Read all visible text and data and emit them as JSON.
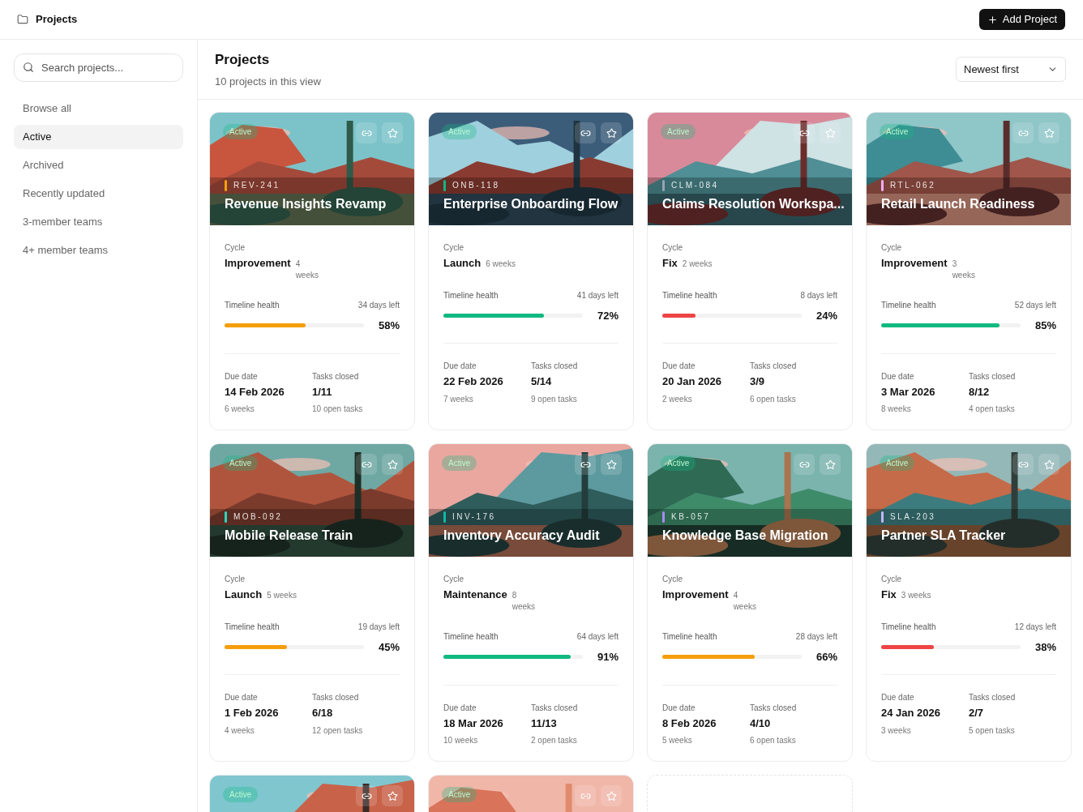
{
  "header": {
    "title": "Projects",
    "action": "Add Project"
  },
  "sidebar": {
    "search": {
      "placeholder": "Search projects..."
    },
    "items": [
      {
        "label": "Browse all",
        "selected": false
      },
      {
        "label": "Active",
        "selected": true
      },
      {
        "label": "Archived",
        "selected": false
      },
      {
        "label": "Recently updated",
        "selected": false
      },
      {
        "label": "3-member teams",
        "selected": false
      },
      {
        "label": "4+ member teams",
        "selected": false
      }
    ]
  },
  "main": {
    "title": "Projects",
    "subtitle": "10 projects in this view",
    "sort": "Newest first"
  },
  "cards": [
    {
      "kind": "full",
      "status": "Active",
      "code": "REV-241",
      "color": "#f59e0b",
      "title": "Revenue Insights Revamp",
      "cycle_label": "Cycle",
      "cycle": "Improvement",
      "cycle_length": "4 weeks",
      "health_label": "Timeline health",
      "days_left": "34 days left",
      "progress": {
        "level": 0.58,
        "color": "#f59e0b"
      },
      "percent": "58%",
      "due_label": "Due date",
      "due": "14 Feb 2026",
      "due_sub": "6 weeks",
      "tasks_label": "Tasks closed",
      "tasks": "1/11",
      "tasks_sub": "10 open tasks"
    },
    {
      "kind": "full",
      "status": "Active",
      "code": "ONB-118",
      "color": "#10b981",
      "title": "Enterprise Onboarding Flow",
      "cycle_label": "Cycle",
      "cycle": "Launch",
      "cycle_length": "6 weeks",
      "health_label": "Timeline health",
      "days_left": "41 days left",
      "progress": {
        "level": 0.72,
        "color": "#10b981"
      },
      "percent": "72%",
      "due_label": "Due date",
      "due": "22 Feb 2026",
      "due_sub": "7 weeks",
      "tasks_label": "Tasks closed",
      "tasks": "5/14",
      "tasks_sub": "9 open tasks"
    },
    {
      "kind": "full",
      "status": "Active",
      "code": "CLM-084",
      "color": "#94a3b8",
      "title": "Claims Resolution Workspa...",
      "cycle_label": "Cycle",
      "cycle": "Fix",
      "cycle_length": "2 weeks",
      "health_label": "Timeline health",
      "days_left": "8 days left",
      "progress": {
        "level": 0.24,
        "color": "#ef4444"
      },
      "percent": "24%",
      "due_label": "Due date",
      "due": "20 Jan 2026",
      "due_sub": "2 weeks",
      "tasks_label": "Tasks closed",
      "tasks": "3/9",
      "tasks_sub": "6 open tasks"
    },
    {
      "kind": "full",
      "status": "Active",
      "code": "RTL-062",
      "color": "#f0abfc",
      "title": "Retail Launch Readiness",
      "cycle_label": "Cycle",
      "cycle": "Improvement",
      "cycle_length": "3 weeks",
      "health_label": "Timeline health",
      "days_left": "52 days left",
      "progress": {
        "level": 0.85,
        "color": "#10b981"
      },
      "percent": "85%",
      "due_label": "Due date",
      "due": "3 Mar 2026",
      "due_sub": "8 weeks",
      "tasks_label": "Tasks closed",
      "tasks": "8/12",
      "tasks_sub": "4 open tasks"
    },
    {
      "kind": "full",
      "status": "Active",
      "code": "MOB-092",
      "color": "#2dd4bf",
      "title": "Mobile Release Train",
      "cycle_label": "Cycle",
      "cycle": "Launch",
      "cycle_length": "5 weeks",
      "health_label": "Timeline health",
      "days_left": "19 days left",
      "progress": {
        "level": 0.45,
        "color": "#f59e0b"
      },
      "percent": "45%",
      "due_label": "Due date",
      "due": "1 Feb 2026",
      "due_sub": "4 weeks",
      "tasks_label": "Tasks closed",
      "tasks": "6/18",
      "tasks_sub": "12 open tasks"
    },
    {
      "kind": "full",
      "status": "Active",
      "code": "INV-176",
      "color": "#14b8a6",
      "title": "Inventory Accuracy Audit",
      "cycle_label": "Cycle",
      "cycle": "Maintenance",
      "cycle_length": "8 weeks",
      "health_label": "Timeline health",
      "days_left": "64 days left",
      "progress": {
        "level": 0.91,
        "color": "#10b981"
      },
      "percent": "91%",
      "due_label": "Due date",
      "due": "18 Mar 2026",
      "due_sub": "10 weeks",
      "tasks_label": "Tasks closed",
      "tasks": "11/13",
      "tasks_sub": "2 open tasks"
    },
    {
      "kind": "full",
      "status": "Active",
      "code": "KB-057",
      "color": "#a78bfa",
      "title": "Knowledge Base Migration",
      "cycle_label": "Cycle",
      "cycle": "Improvement",
      "cycle_length": "4 weeks",
      "health_label": "Timeline health",
      "days_left": "28 days left",
      "progress": {
        "level": 0.66,
        "color": "#f59e0b"
      },
      "percent": "66%",
      "due_label": "Due date",
      "due": "8 Feb 2026",
      "due_sub": "5 weeks",
      "tasks_label": "Tasks closed",
      "tasks": "4/10",
      "tasks_sub": "6 open tasks"
    },
    {
      "kind": "full",
      "status": "Active",
      "code": "SLA-203",
      "color": "#c4b5fd",
      "title": "Partner SLA Tracker",
      "cycle_label": "Cycle",
      "cycle": "Fix",
      "cycle_length": "3 weeks",
      "health_label": "Timeline health",
      "days_left": "12 days left",
      "progress": {
        "level": 0.38,
        "color": "#ef4444"
      },
      "percent": "38%",
      "due_label": "Due date",
      "due": "24 Jan 2026",
      "due_sub": "3 weeks",
      "tasks_label": "Tasks closed",
      "tasks": "2/7",
      "tasks_sub": "5 open tasks"
    },
    {
      "kind": "partial",
      "status": "Active"
    },
    {
      "kind": "partial",
      "status": "Active"
    },
    {
      "kind": "placeholder"
    }
  ]
}
